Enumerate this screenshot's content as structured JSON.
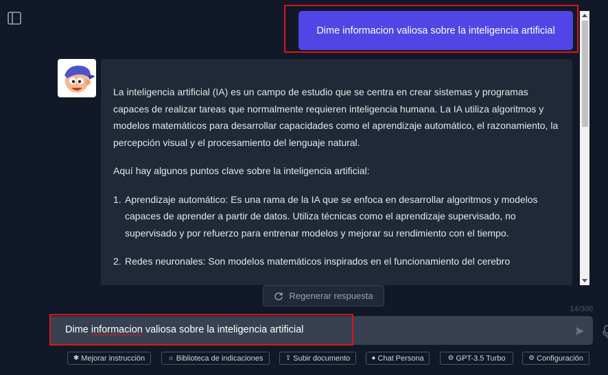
{
  "user_message": "Dime informacion valiosa sobre la inteligencia artificial",
  "assistant": {
    "intro": "La inteligencia artificial (IA) es un campo de estudio que se centra en crear sistemas y programas capaces de realizar tareas que normalmente requieren inteligencia humana. La IA utiliza algoritmos y modelos matemáticos para desarrollar capacidades como el aprendizaje automático, el razonamiento, la percepción visual y el procesamiento del lenguaje natural.",
    "lead": "Aquí hay algunos puntos clave sobre la inteligencia artificial:",
    "points": [
      {
        "num": "1.",
        "text": "Aprendizaje automático: Es una rama de la IA que se enfoca en desarrollar algoritmos y modelos capaces de aprender a partir de datos. Utiliza técnicas como el aprendizaje supervisado, no supervisado y por refuerzo para entrenar modelos y mejorar su rendimiento con el tiempo."
      },
      {
        "num": "2.",
        "text": "Redes neuronales: Son modelos matemáticos inspirados en el funcionamiento del cerebro"
      }
    ]
  },
  "regenerate_label": "Regenerar respuesta",
  "char_counter": "14/300",
  "input": {
    "value_pre": "Dime ",
    "value_spell": "informacion",
    "value_post": " valiosa sobre la inteligencia artificial"
  },
  "toolbar": {
    "improve": "Mejorar instrucción",
    "library": "Biblioteca de indicaciones",
    "upload": "Subir documento",
    "persona": "Chat Persona",
    "model": "GPT-3.5 Turbo",
    "settings": "Configuración"
  },
  "colors": {
    "background": "#111827",
    "user_bubble": "#4f46e5",
    "assistant_bubble": "#1f2937",
    "highlight": "#e0141e"
  }
}
